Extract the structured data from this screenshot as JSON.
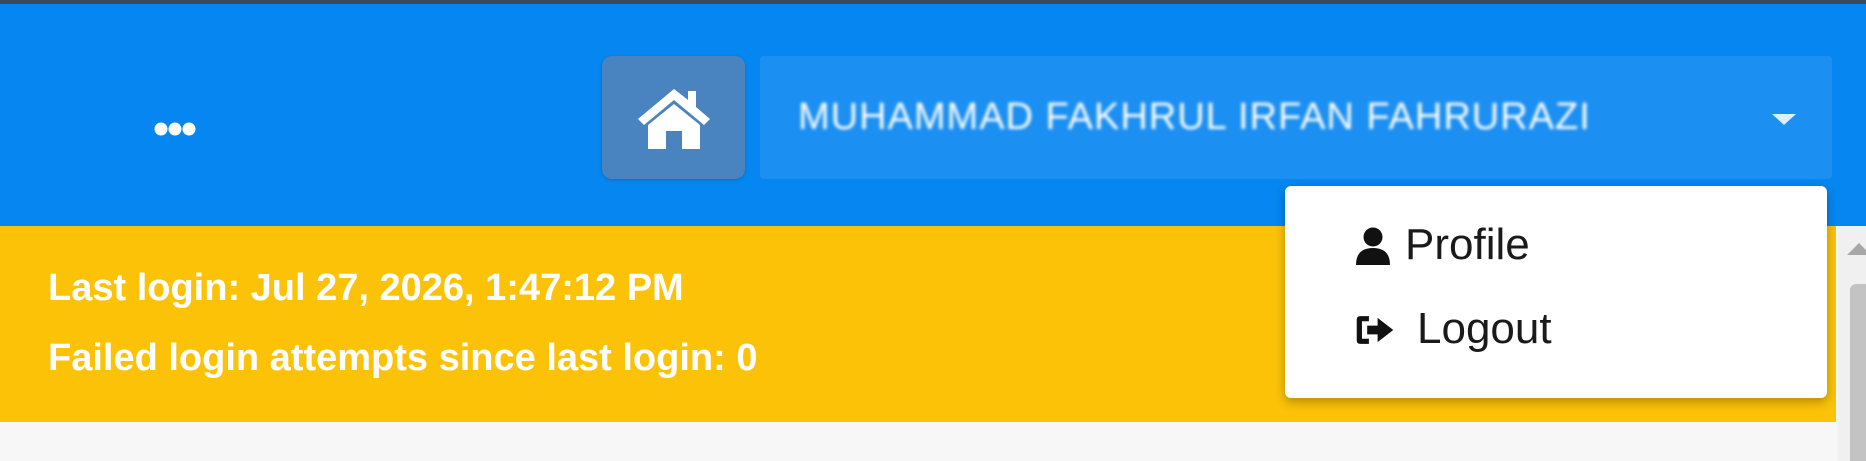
{
  "header": {
    "more_icon": "ellipsis-icon",
    "home_icon": "home-icon",
    "user_name": "MUHAMMAD FAKHRUL IRFAN FAHRURAZI",
    "dropdown_icon": "caret-down-icon"
  },
  "alert": {
    "last_login_label": "Last login:",
    "last_login_value": " Jul 27, 2026, 1:47:12 PM",
    "failed_attempts_text": "Failed login attempts since last login: 0"
  },
  "user_menu": {
    "items": [
      {
        "label": "Profile",
        "icon": "user-icon"
      },
      {
        "label": "Logout",
        "icon": "sign-out-icon"
      }
    ]
  },
  "colors": {
    "header_bg": "#0686f0",
    "home_button_bg": "#4a84c0",
    "alert_bg": "#fbc208",
    "menu_bg": "#ffffff"
  }
}
